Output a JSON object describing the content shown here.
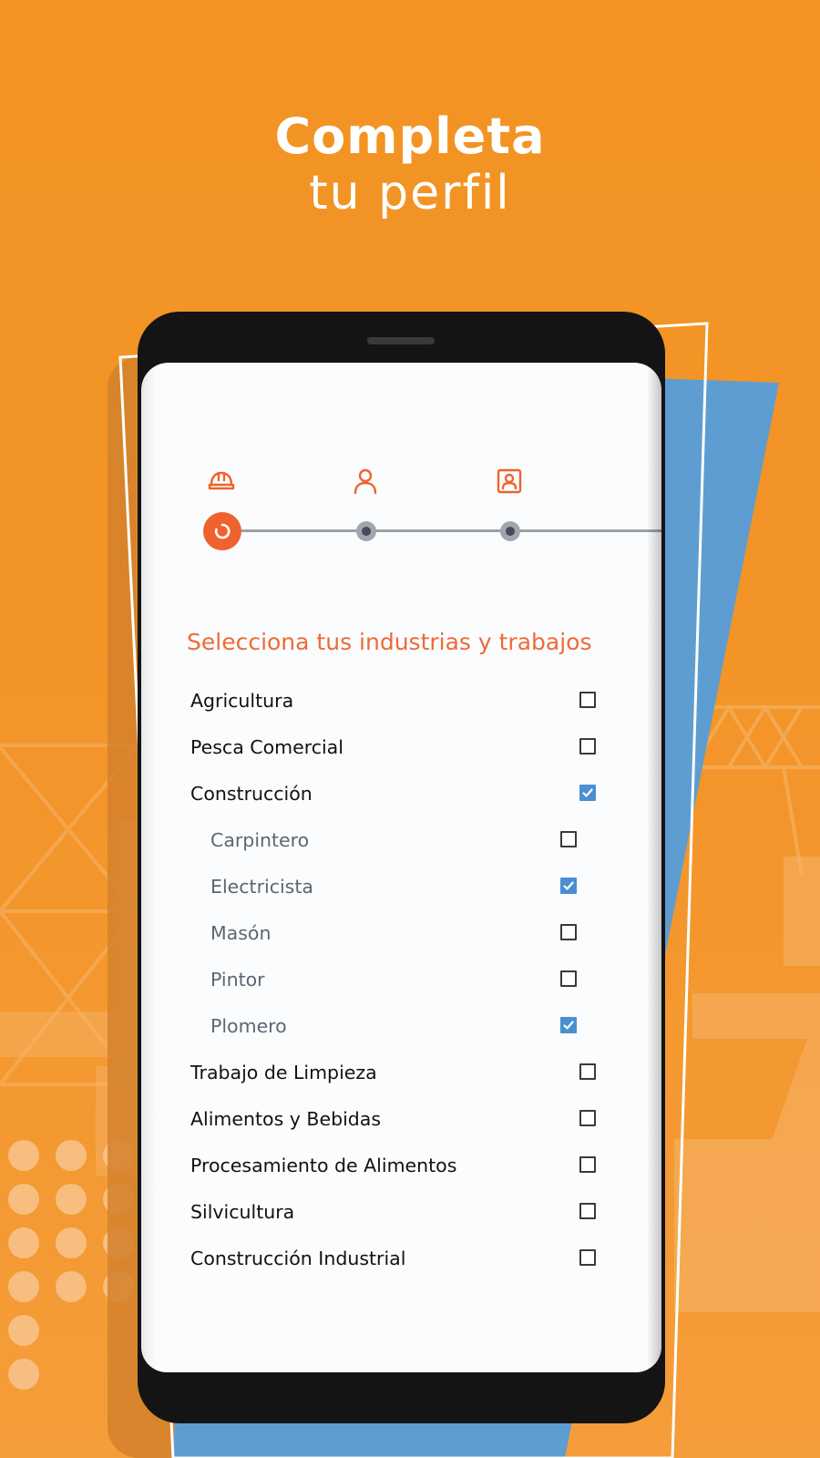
{
  "header": {
    "title": "Completa",
    "subtitle": "tu perfil"
  },
  "colors": {
    "background": "#f29324",
    "accent": "#f0622d",
    "checkbox_checked": "#4a8fcf",
    "phone_frame": "#141414"
  },
  "stepper": {
    "steps": [
      {
        "icon": "hard-hat-icon",
        "state": "active"
      },
      {
        "icon": "user-icon",
        "state": "pending"
      },
      {
        "icon": "profile-card-icon",
        "state": "pending"
      }
    ]
  },
  "section": {
    "title": "Selecciona tus industrias y trabajos"
  },
  "items": [
    {
      "label": "Agricultura",
      "checked": false,
      "level": 0
    },
    {
      "label": "Pesca Comercial",
      "checked": false,
      "level": 0
    },
    {
      "label": "Construcción",
      "checked": true,
      "level": 0
    },
    {
      "label": "Carpintero",
      "checked": false,
      "level": 1
    },
    {
      "label": "Electricista",
      "checked": true,
      "level": 1
    },
    {
      "label": "Masón",
      "checked": false,
      "level": 1
    },
    {
      "label": "Pintor",
      "checked": false,
      "level": 1
    },
    {
      "label": "Plomero",
      "checked": true,
      "level": 1
    },
    {
      "label": "Trabajo de Limpieza",
      "checked": false,
      "level": 0
    },
    {
      "label": "Alimentos y Bebidas",
      "checked": false,
      "level": 0
    },
    {
      "label": "Procesamiento de Alimentos",
      "checked": false,
      "level": 0
    },
    {
      "label": "Silvicultura",
      "checked": false,
      "level": 0
    },
    {
      "label": "Construcción Industrial",
      "checked": false,
      "level": 0
    }
  ]
}
